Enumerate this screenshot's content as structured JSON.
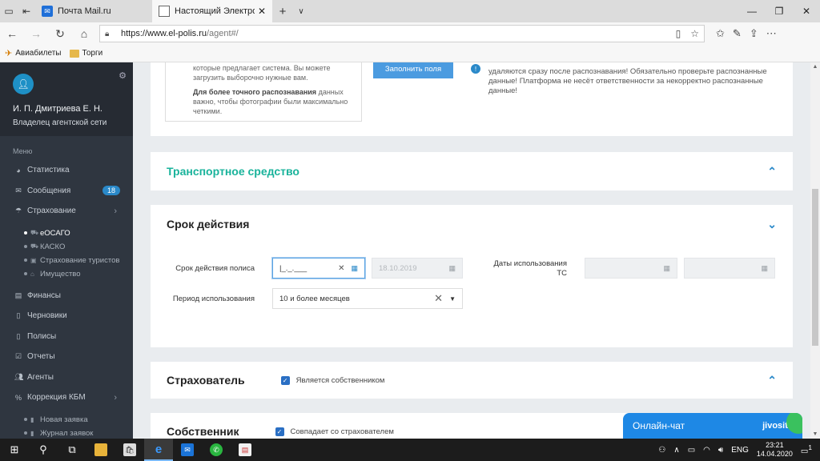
{
  "browser": {
    "tabs": [
      {
        "title": "Почта Mail.ru",
        "active": false
      },
      {
        "title": "Настоящий Электронн",
        "active": true
      }
    ],
    "url_main": "https://www.el-polis.ru",
    "url_rest": "/agent#/",
    "favorites": [
      {
        "label": "Авиабилеты",
        "icon": "plane-icon"
      },
      {
        "label": "Торги",
        "icon": "folder-icon"
      }
    ]
  },
  "sidebar": {
    "user_name": "И. П. Дмитриева Е. Н.",
    "user_role": "Владелец агентской сети",
    "menu_label": "Меню",
    "items": [
      {
        "label": "Статистика",
        "icon": "pie-chart-icon"
      },
      {
        "label": "Сообщения",
        "icon": "envelope-icon",
        "badge": "18"
      },
      {
        "label": "Страхование",
        "icon": "umbrella-icon"
      },
      {
        "label": "Финансы",
        "icon": "money-icon"
      },
      {
        "label": "Черновики",
        "icon": "document-icon"
      },
      {
        "label": "Полисы",
        "icon": "file-icon"
      },
      {
        "label": "Отчеты",
        "icon": "report-icon"
      },
      {
        "label": "Агенты",
        "icon": "users-icon"
      },
      {
        "label": "Коррекция КБМ",
        "icon": "percent-icon"
      }
    ],
    "insurance_sub": [
      {
        "label": "еОСАГО",
        "active": true
      },
      {
        "label": "КАСКО",
        "active": false
      },
      {
        "label": "Страхование туристов",
        "active": false
      },
      {
        "label": "Имущество",
        "active": false
      }
    ],
    "kbm_sub": [
      {
        "label": "Новая заявка"
      },
      {
        "label": "Журнал заявок"
      }
    ]
  },
  "top_card": {
    "hint_line1": "которые предлагает система. Вы можете загрузить выборочно нужные вам.",
    "hint_bold": "Для более точного распознавания",
    "hint_rest": " данных важно, чтобы фотографии были максимально четкими.",
    "fill_button": "Заполнить поля",
    "warning": "удаляются сразу после распознавания! Обязательно проверьте распознанные данные! Платформа не несёт ответственности за некорректно распознанные данные!"
  },
  "sections": {
    "transport_title": "Транспортное средство",
    "validity_title": "Срок действия",
    "insurer_title": "Страхователь",
    "insurer_check": "Является собственником",
    "owner_title": "Собственник",
    "owner_check": "Совпадает со страхователем"
  },
  "validity_form": {
    "policy_label": "Срок действия полиса",
    "policy_value": "|_._.___",
    "policy_end": "18.10.2019",
    "usage_dates_label_1": "Даты использования",
    "usage_dates_label_2": "ТС",
    "period_label": "Период использования",
    "period_value": "10 и более месяцев"
  },
  "chat": {
    "label": "Онлайн-чат",
    "brand": "jivosite"
  },
  "taskbar": {
    "lang": "ENG",
    "time": "23:21",
    "date": "14.04.2020",
    "notif_count": "1"
  }
}
